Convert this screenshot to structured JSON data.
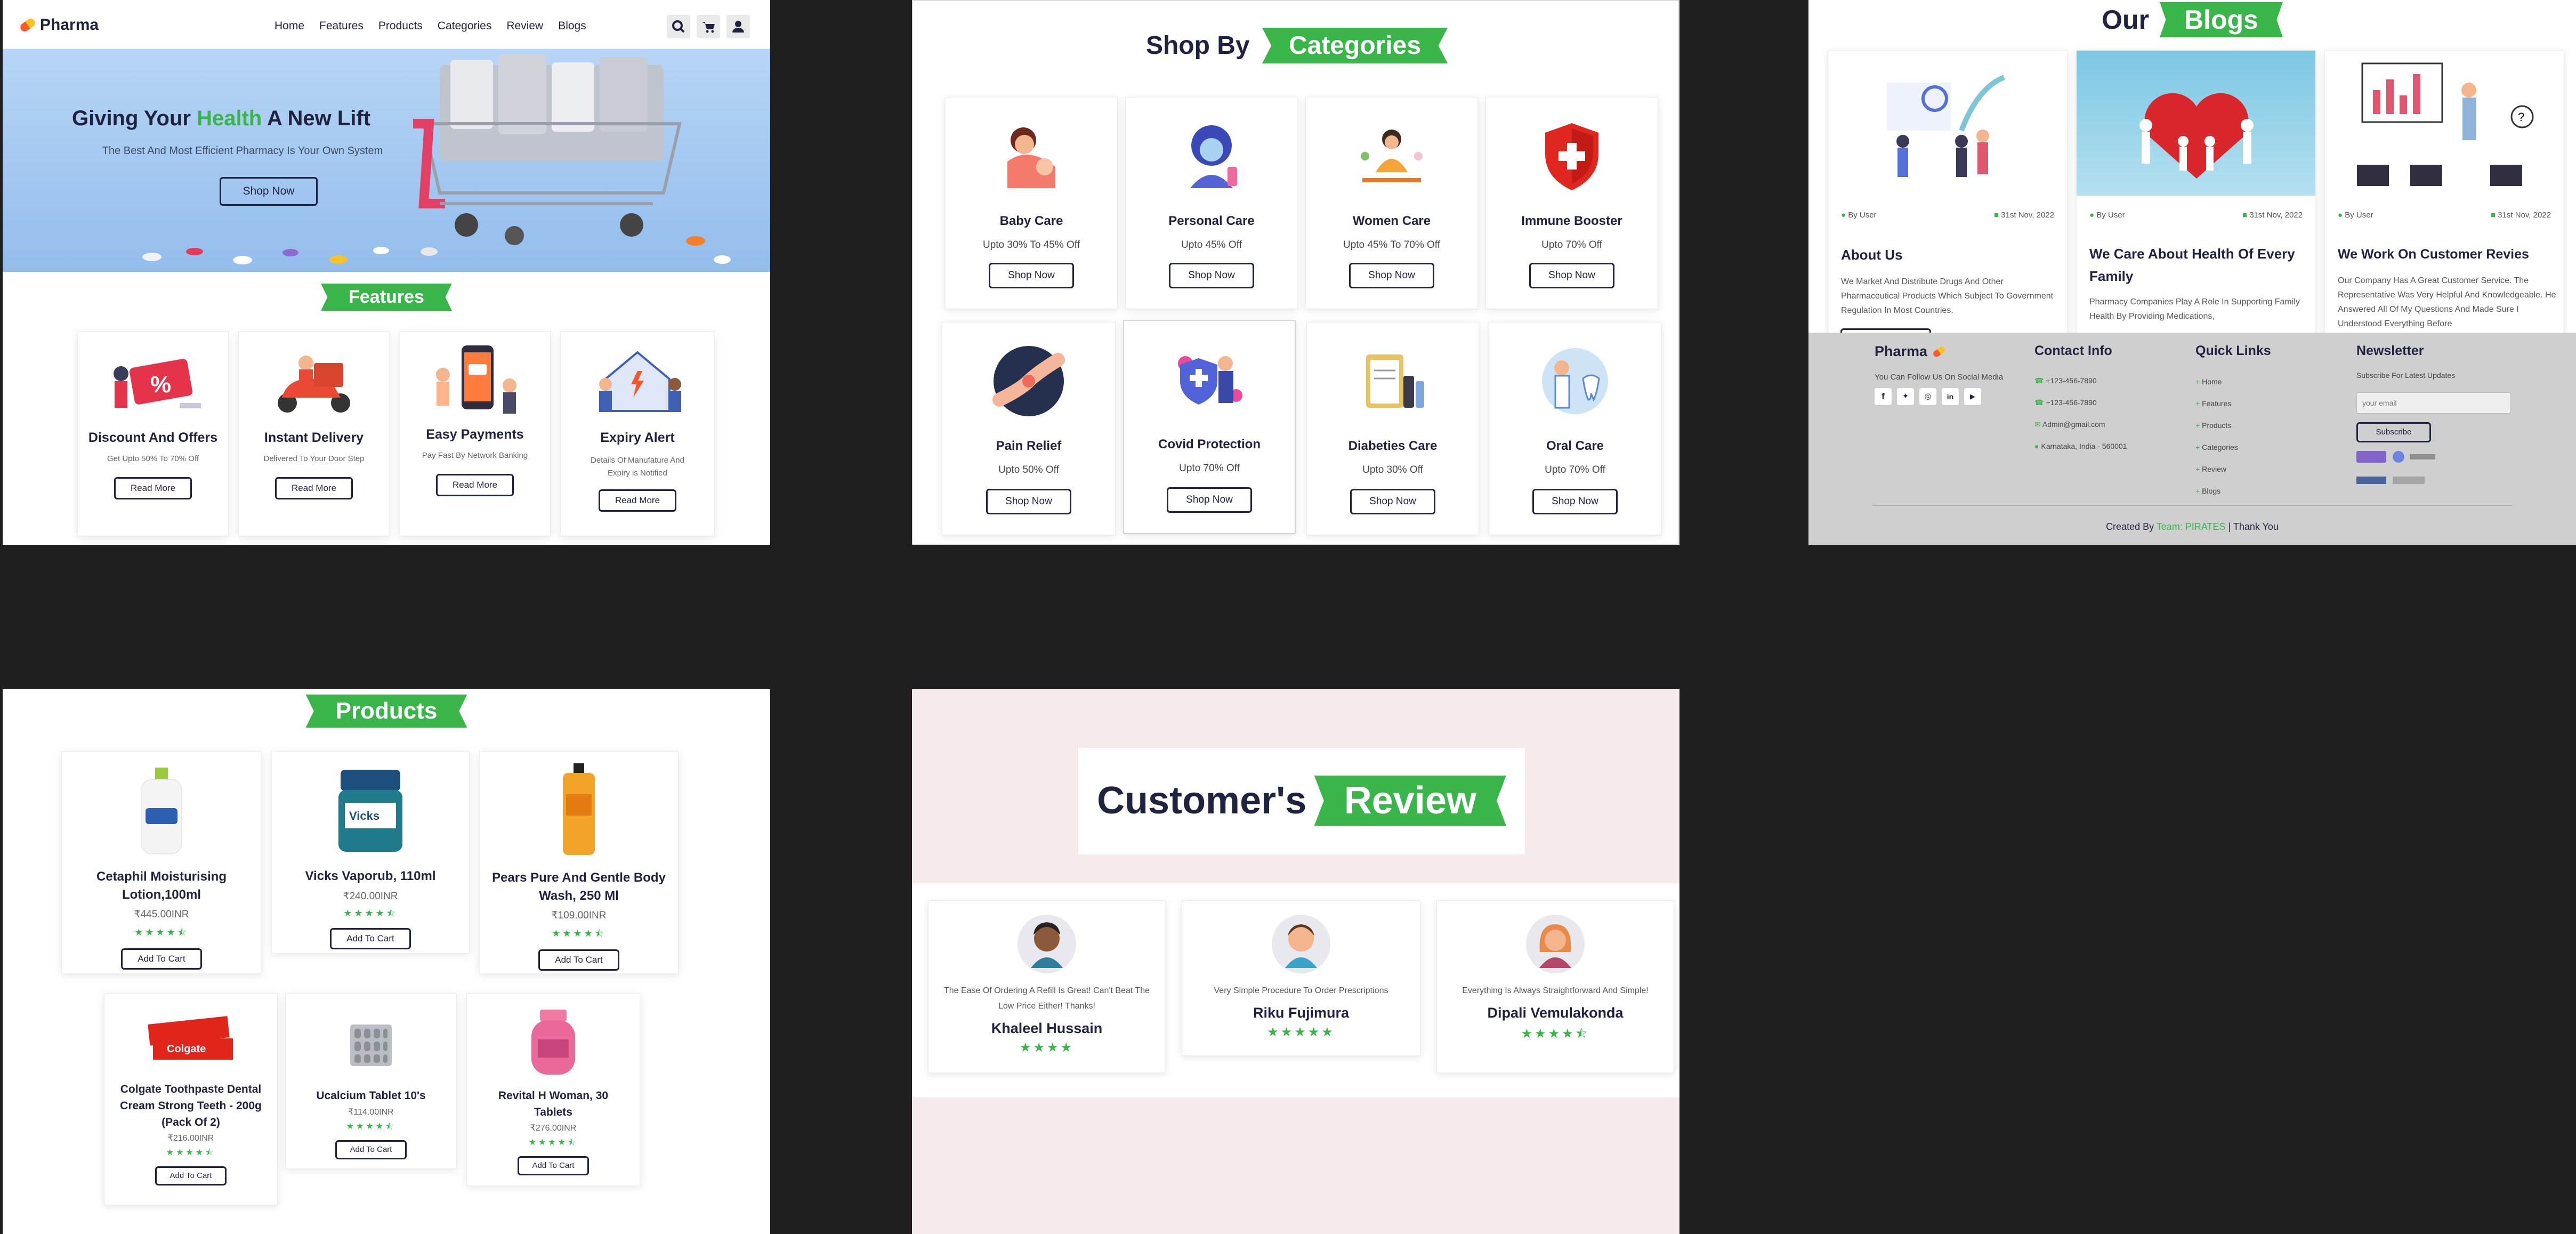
{
  "home": {
    "brand": "Pharma",
    "nav": [
      "Home",
      "Features",
      "Products",
      "Categories",
      "Review",
      "Blogs"
    ],
    "hero_title_pre": "Giving Your ",
    "hero_title_accent": "Health",
    "hero_title_post": " A New Lift",
    "hero_subtitle": "The Best And Most Efficient Pharmacy Is Your Own System",
    "hero_button": "Shop Now",
    "features_heading": "Features",
    "features": [
      {
        "title": "Discount And Offers",
        "desc": "Get Upto 50% To 70% Off",
        "button": "Read More"
      },
      {
        "title": "Instant Delivery",
        "desc": "Delivered To Your Door Step",
        "button": "Read More"
      },
      {
        "title": "Easy Payments",
        "desc": "Pay Fast By Network Banking",
        "button": "Read More"
      },
      {
        "title": "Expiry Alert",
        "desc": "Details Of Manufature And Expiry is Notified",
        "button": "Read More"
      }
    ]
  },
  "categories": {
    "heading_pre": "Shop By",
    "heading_accent": "Categories",
    "items": [
      {
        "name": "Baby Care",
        "offer": "Upto 30% To 45% Off",
        "button": "Shop Now"
      },
      {
        "name": "Personal Care",
        "offer": "Upto 45% Off",
        "button": "Shop Now"
      },
      {
        "name": "Women Care",
        "offer": "Upto 45% To 70% Off",
        "button": "Shop Now"
      },
      {
        "name": "Immune Booster",
        "offer": "Upto 70% Off",
        "button": "Shop Now"
      },
      {
        "name": "Pain Relief",
        "offer": "Upto 50% Off",
        "button": "Shop Now"
      },
      {
        "name": "Covid Protection",
        "offer": "Upto 70% Off",
        "button": "Shop Now"
      },
      {
        "name": "Diabeties Care",
        "offer": "Upto 30% Off",
        "button": "Shop Now"
      },
      {
        "name": "Oral Care",
        "offer": "Upto 70% Off",
        "button": "Shop Now"
      }
    ]
  },
  "blogs": {
    "heading_pre": "Our",
    "heading_accent": "Blogs",
    "posts": [
      {
        "author": "By User",
        "date": "31st Nov, 2022",
        "title": "About Us",
        "text": "We Market And Distribute Drugs And Other Pharmaceutical Products Which Subject To Government Regulation In Most Countries."
      },
      {
        "author": "By User",
        "date": "31st Nov, 2022",
        "title": "We Care About Health Of Every Family",
        "text": "Pharmacy Companies Play A Role In Supporting Family Health By Providing Medications,"
      },
      {
        "author": "By User",
        "date": "31st Nov, 2022",
        "title": "We Work On Customer Revies",
        "text": "Our Company Has A Great Customer Service. The Representative Was Very Helpful And Knowledgeable. He Answered All Of My Questions And Made Sure I Understood Everything Before"
      }
    ]
  },
  "footer": {
    "brand": "Pharma",
    "social_text": "You Can Follow Us On Social Media",
    "contact_heading": "Contact Info",
    "contacts": [
      "+123-456-7890",
      "+123-456-7890",
      "Admin@gmail.com",
      "Karnataka, India - 560001"
    ],
    "links_heading": "Quick Links",
    "links": [
      "Home",
      "Features",
      "Products",
      "Categories",
      "Review",
      "Blogs"
    ],
    "newsletter_heading": "Newsletter",
    "newsletter_text": "Subscribe For Latest Updates",
    "email_placeholder": "your email",
    "subscribe": "Subscribe",
    "credit_pre": "Created By ",
    "credit_team": "Team: PIRATES",
    "credit_post": " | Thank You"
  },
  "products": {
    "heading": "Products",
    "items": [
      {
        "name": "Cetaphil Moisturising Lotion,100ml",
        "price": "₹445.00INR",
        "button": "Add To Cart",
        "rating": 4.5
      },
      {
        "name": "Vicks Vaporub, 110ml",
        "price": "₹240.00INR",
        "button": "Add To Cart",
        "rating": 4.5
      },
      {
        "name": "Pears Pure And Gentle Body Wash, 250 Ml",
        "price": "₹109.00INR",
        "button": "Add To Cart",
        "rating": 4.5
      },
      {
        "name": "Colgate Toothpaste Dental Cream Strong Teeth - 200g (Pack Of 2)",
        "price": "₹216.00INR",
        "button": "Add To Cart",
        "rating": 4.5
      },
      {
        "name": "Ucalcium Tablet 10's",
        "price": "₹114.00INR",
        "button": "Add To Cart",
        "rating": 4.5
      },
      {
        "name": "Revital H Woman, 30 Tablets",
        "price": "₹276.00INR",
        "button": "Add To Cart",
        "rating": 4.5
      }
    ]
  },
  "reviews": {
    "heading_pre": "Customer's",
    "heading_accent": "Review",
    "items": [
      {
        "text": "The Ease Of Ordering A Refill Is Great! Can't Beat The Low Price Either! Thanks!",
        "name": "Khaleel Hussain",
        "rating": 4
      },
      {
        "text": "Very Simple Procedure To Order Prescriptions",
        "name": "Riku Fujimura",
        "rating": 5
      },
      {
        "text": "Everything Is Always Straightforward And Simple!",
        "name": "Dipali Vemulakonda",
        "rating": 4.5
      }
    ]
  },
  "colors": {
    "accent": "#39b54a",
    "navy": "#1f2340",
    "hero_bg": "#a9cdf4",
    "review_bg": "#f7eaea",
    "footer_bg": "#cfcfcf"
  }
}
